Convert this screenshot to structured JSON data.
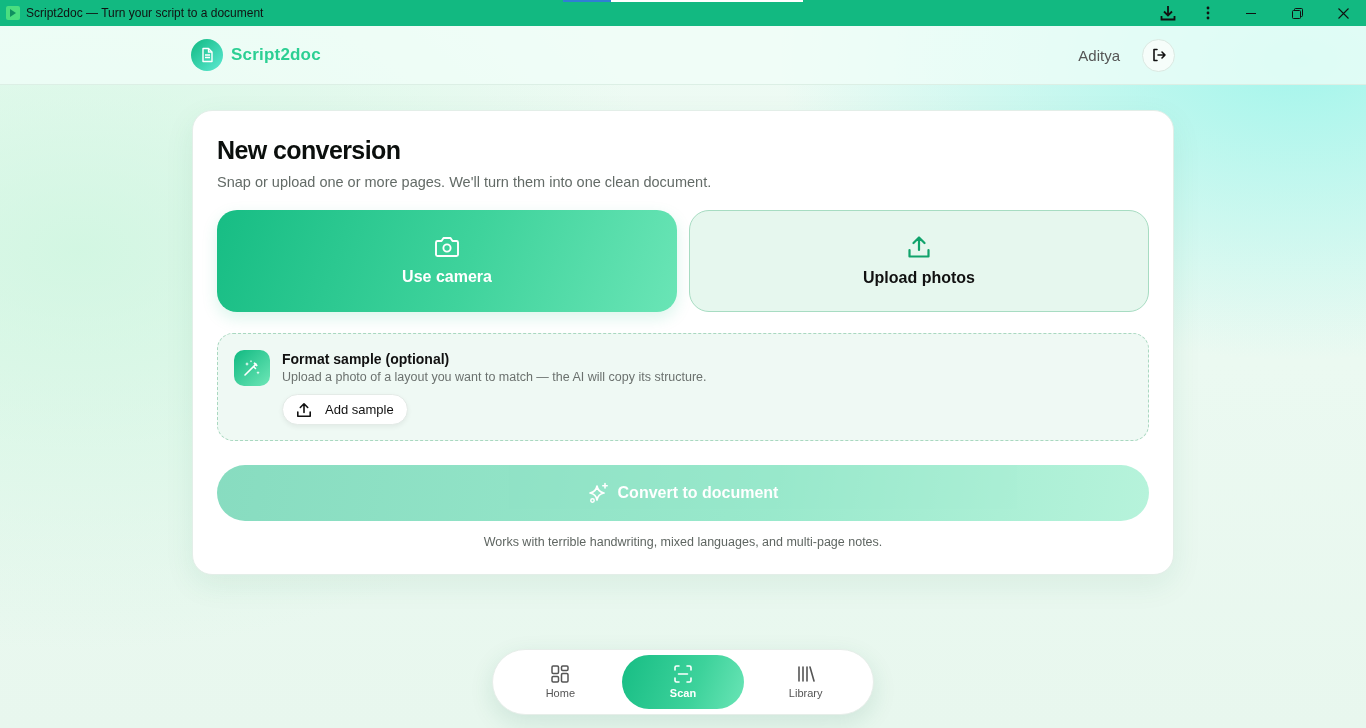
{
  "window": {
    "title": "Script2doc — Turn your script to a document",
    "loading_bar": {
      "level": 0.2
    }
  },
  "header": {
    "brand": "Script2doc",
    "user": "Aditya"
  },
  "conversion": {
    "title": "New conversion",
    "subtitle": "Snap or upload one or more pages. We'll turn them into one clean document.",
    "sources": [
      {
        "kind": "camera",
        "label": "Use camera"
      },
      {
        "kind": "upload",
        "label": "Upload photos"
      }
    ],
    "format_sample": {
      "title": "Format sample (optional)",
      "description": "Upload a photo of a layout you want to match — the AI will copy its structure.",
      "button": "Add sample"
    },
    "convert_button": {
      "label": "Convert to document",
      "disabled": true
    },
    "footnote": "Works with terrible handwriting, mixed languages, and multi-page notes."
  },
  "nav": [
    {
      "kind": "home",
      "label": "Home",
      "selected": false
    },
    {
      "kind": "scan",
      "label": "Scan",
      "selected": true
    },
    {
      "kind": "library",
      "label": "Library",
      "selected": false
    }
  ]
}
